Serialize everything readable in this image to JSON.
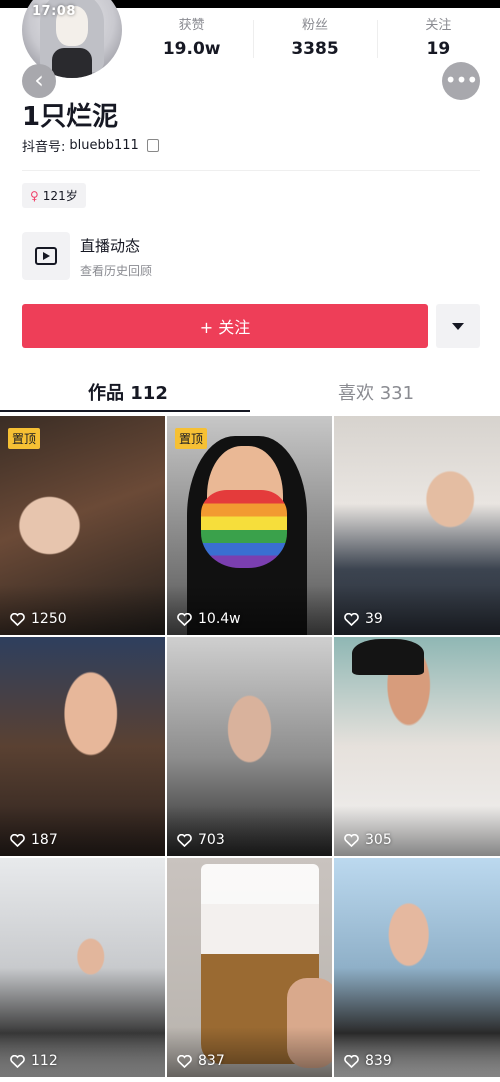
{
  "status": {
    "time": "17:08"
  },
  "profile": {
    "name": "1只烂泥",
    "douyin_id_label": "抖音号:",
    "douyin_id": "bluebb111",
    "age_tag": "121岁",
    "gender_symbol": "♀"
  },
  "stats": [
    {
      "label": "获赞",
      "value": "19.0w"
    },
    {
      "label": "粉丝",
      "value": "3385"
    },
    {
      "label": "关注",
      "value": "19"
    }
  ],
  "live": {
    "title": "直播动态",
    "subtitle": "查看历史回顾"
  },
  "actions": {
    "follow_label": "+ 关注"
  },
  "tabs": [
    {
      "label": "作品 112",
      "active": true
    },
    {
      "label": "喜欢 331",
      "active": false
    }
  ],
  "pin_label": "置顶",
  "videos": [
    {
      "likes": "1250",
      "pinned": true
    },
    {
      "likes": "10.4w",
      "pinned": true
    },
    {
      "likes": "39",
      "pinned": false
    },
    {
      "likes": "187",
      "pinned": false
    },
    {
      "likes": "703",
      "pinned": false
    },
    {
      "likes": "305",
      "pinned": false
    },
    {
      "likes": "112",
      "pinned": false
    },
    {
      "likes": "837",
      "pinned": false
    },
    {
      "likes": "839",
      "pinned": false
    }
  ],
  "colors": {
    "accent": "#ee3e58",
    "pin": "#f6c034",
    "gender": "#f0426a"
  },
  "icons": [
    "back-icon",
    "more-icon",
    "copy-icon",
    "tv-icon",
    "caret-down-icon",
    "heart-icon"
  ]
}
